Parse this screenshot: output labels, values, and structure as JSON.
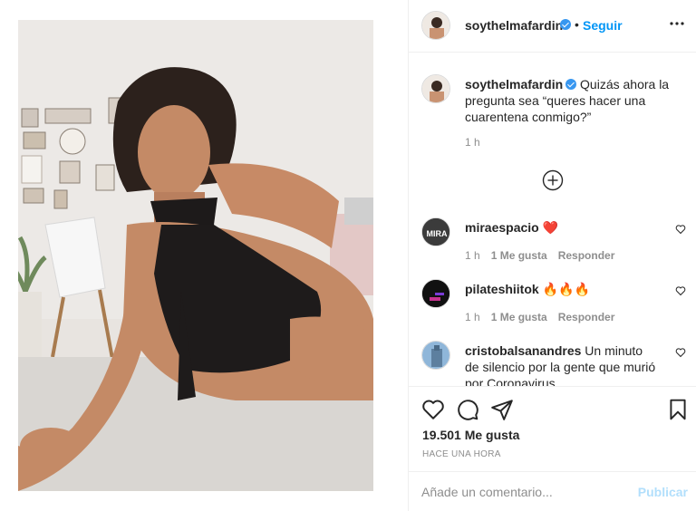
{
  "post": {
    "username": "soythelmafardin",
    "follow_label": "Seguir",
    "separator": "•"
  },
  "caption": {
    "username": "soythelmafardin",
    "text": "Quizás ahora la pregunta sea “queres hacer una cuarentena conmigo?”",
    "time": "1 h"
  },
  "comments": [
    {
      "username": "miraespacio",
      "text": "❤️",
      "avatar_text": "MIRA",
      "time": "1 h",
      "likes": "1 Me gusta",
      "reply": "Responder"
    },
    {
      "username": "pilateshiitok",
      "text": "🔥🔥🔥",
      "time": "1 h",
      "likes": "1 Me gusta",
      "reply": "Responder"
    },
    {
      "username": "cristobalsanandres",
      "text": "Un minuto de silencio por la gente que murió por Coronavirus"
    }
  ],
  "likes_count": "19.501 Me gusta",
  "timestamp": "HACE UNA HORA",
  "add_comment": {
    "placeholder": "Añade un comentario...",
    "publish_label": "Publicar"
  },
  "icons": {
    "more": "more-horizontal-icon",
    "load_more": "plus-circle-icon",
    "like": "heart-icon",
    "comment": "comment-icon",
    "share": "paper-plane-icon",
    "save": "bookmark-icon"
  },
  "colors": {
    "accent": "#0095f6",
    "verified": "#3897f0",
    "heart_red": "#ed4956",
    "publish_disabled": "#b2dffc",
    "muted": "#8e8e8e"
  }
}
